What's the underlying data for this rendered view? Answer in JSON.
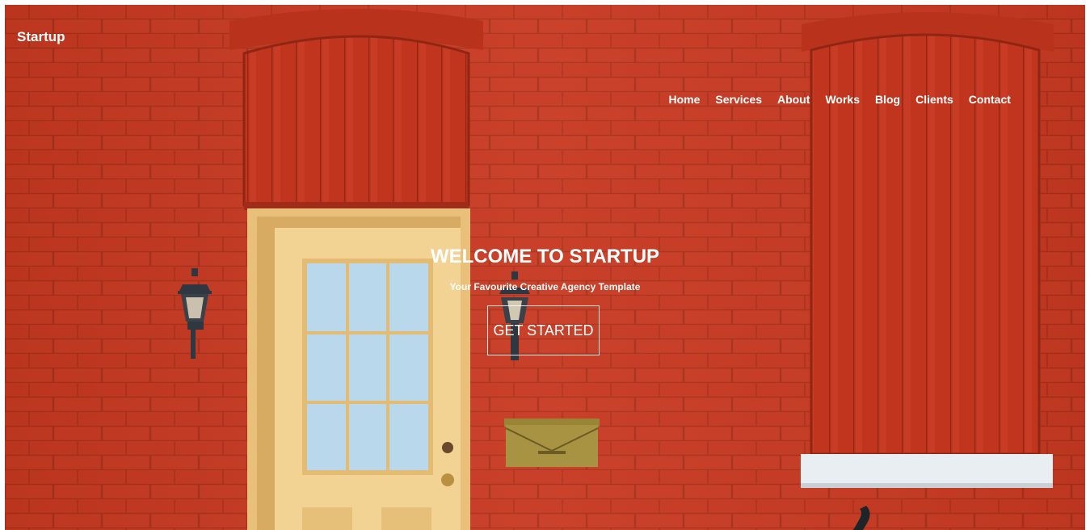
{
  "brand": {
    "name": "Startup"
  },
  "nav": {
    "items": [
      {
        "label": "Home"
      },
      {
        "label": "Services"
      },
      {
        "label": "About"
      },
      {
        "label": "Works"
      },
      {
        "label": "Blog"
      },
      {
        "label": "Clients"
      },
      {
        "label": "Contact"
      }
    ]
  },
  "hero": {
    "title": "WELCOME TO STARTUP",
    "subtitle": "Your Favourite Creative Agency Template",
    "cta_label": "GET STARTED",
    "background": "red-brick-wall-photo"
  },
  "colors": {
    "brick": "#c5361f",
    "brick_dark": "#a82c19",
    "door": "#f0cf8e",
    "glass": "#b8d7ea",
    "sill": "#e8eef2",
    "text": "#ffffff"
  }
}
